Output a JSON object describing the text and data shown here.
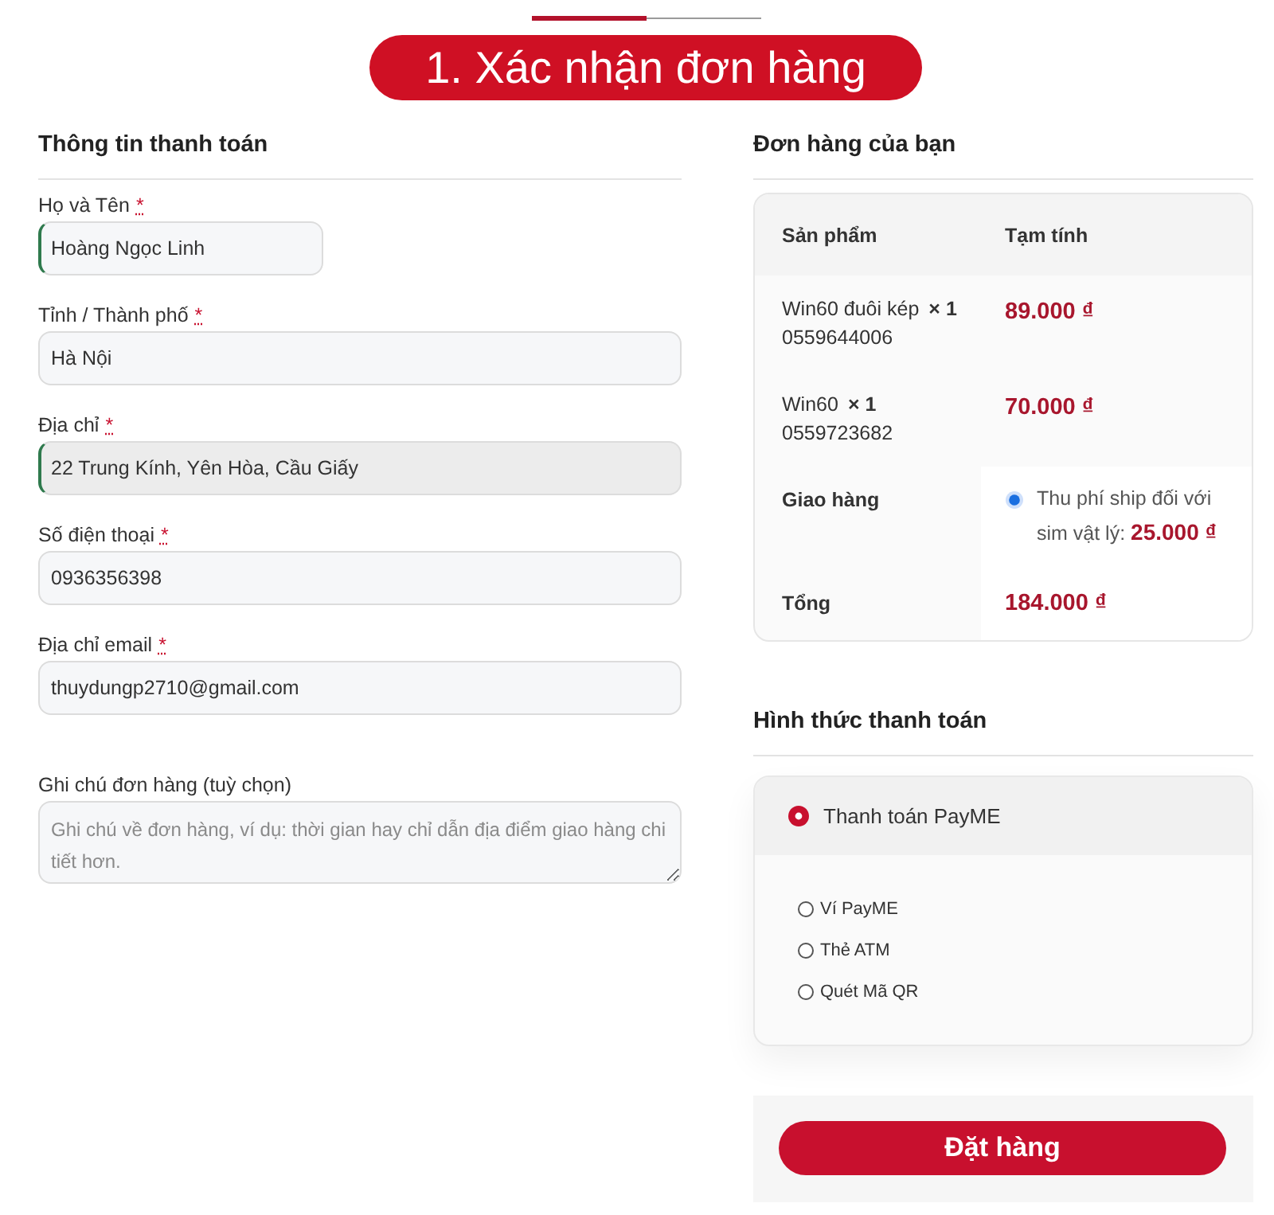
{
  "progress": {
    "level": 0.5
  },
  "title": "1. Xác nhận đơn hàng",
  "billing": {
    "heading": "Thông tin thanh toán",
    "fields": [
      {
        "kind": "short",
        "label": "Họ và Tên",
        "required_mark": "*",
        "value": "Hoàng Ngọc Linh",
        "validated": true,
        "focused": false
      },
      {
        "kind": "text",
        "label": "Tỉnh / Thành phố",
        "required_mark": "*",
        "value": "Hà Nội",
        "validated": false,
        "focused": false
      },
      {
        "kind": "text",
        "label": "Địa chỉ",
        "required_mark": "*",
        "value": "22 Trung Kính, Yên Hòa, Cầu Giấy",
        "validated": true,
        "focused": true
      },
      {
        "kind": "text",
        "label": "Số điện thoại",
        "required_mark": "*",
        "value": "0936356398",
        "validated": false,
        "focused": false
      },
      {
        "kind": "text",
        "label": "Địa chỉ email",
        "required_mark": "*",
        "value": "thuydungp2710@gmail.com",
        "validated": false,
        "focused": false
      },
      {
        "kind": "textarea",
        "label": "Ghi chú đơn hàng (tuỳ chọn)",
        "placeholder": "Ghi chú về đơn hàng, ví dụ: thời gian hay chỉ dẫn địa điểm giao hàng chi tiết hơn.",
        "validated": false,
        "focused": false
      }
    ]
  },
  "order": {
    "heading": "Đơn hàng của bạn",
    "columns": [
      "Sản phẩm",
      "Tạm tính"
    ],
    "items": [
      {
        "name": "Win60 đuôi kép",
        "quantity": "× 1",
        "sim_number": "0559644006",
        "price": "89.000 ₫"
      },
      {
        "name": "Win60",
        "quantity": "× 1",
        "sim_number": "0559723682",
        "price": "70.000 ₫"
      }
    ],
    "shipping": {
      "label": "Giao hàng",
      "option": {
        "text": "Thu phí ship đối với sim vật lý: **25.000 ₫**",
        "selected": true
      }
    },
    "total": {
      "label": "Tổng",
      "value": "184.000 ₫"
    }
  },
  "payment": {
    "heading": "Hình thức thanh toán",
    "methods": [
      {
        "label": "Thanh toán PayME",
        "selected": true,
        "options": [
          {
            "label": "Ví PayME",
            "selected": false
          },
          {
            "label": "Thẻ ATM",
            "selected": false
          },
          {
            "label": "Quét Mã QR",
            "selected": false
          }
        ]
      }
    ]
  },
  "place_order": {
    "label": "Đặt hàng"
  }
}
